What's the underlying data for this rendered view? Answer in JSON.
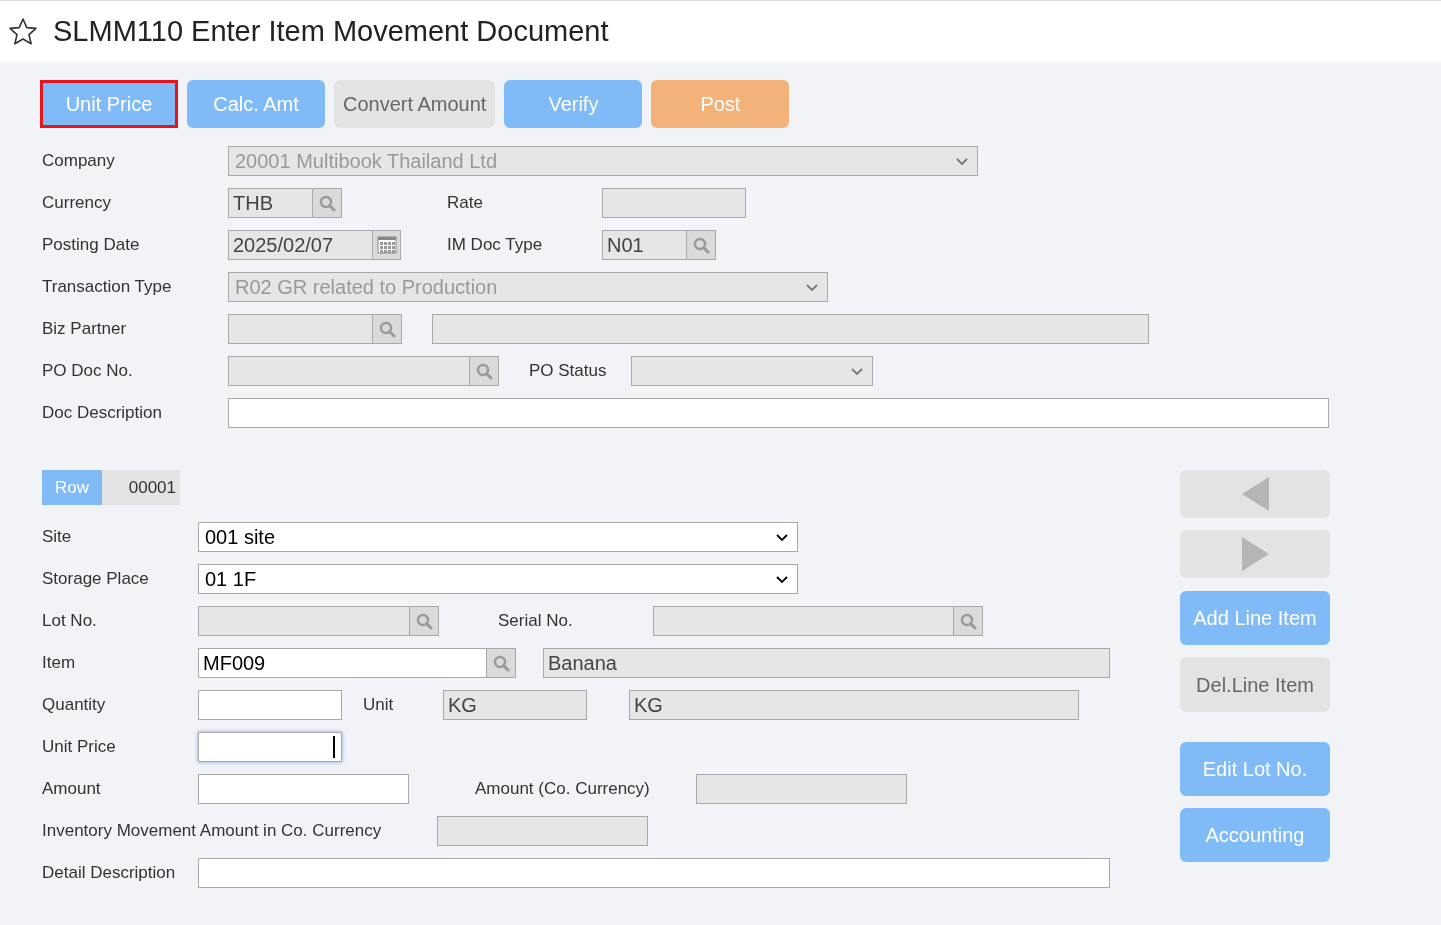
{
  "title": "SLMM110 Enter Item Movement Document",
  "starred": false,
  "toolbar": [
    {
      "label": "Unit Price",
      "kind": "primary",
      "focused": true
    },
    {
      "label": "Calc. Amt",
      "kind": "primary",
      "focused": false
    },
    {
      "label": "Convert Amount",
      "kind": "disabled",
      "focused": false
    },
    {
      "label": "Verify",
      "kind": "primary",
      "focused": false
    },
    {
      "label": "Post",
      "kind": "warning",
      "focused": false
    }
  ],
  "header": {
    "company": {
      "label": "Company",
      "value": "20001 Multibook Thailand Ltd",
      "disabled": true
    },
    "currency": {
      "label": "Currency",
      "value": "THB",
      "editable": false
    },
    "rate": {
      "label": "Rate",
      "editable": false
    },
    "posting_date": {
      "label": "Posting Date",
      "value": "2025/02/07",
      "editable": false
    },
    "im_doc_type": {
      "label": "IM Doc Type",
      "value": "N01",
      "editable": false
    },
    "transaction_type": {
      "label": "Transaction Type",
      "value": "R02 GR related to Production",
      "disabled": true
    },
    "biz_partner": {
      "label": "Biz Partner",
      "editable": false
    },
    "po_doc_no": {
      "label": "PO Doc No.",
      "editable": false
    },
    "po_status": {
      "label": "PO Status",
      "disabled": true
    },
    "doc_description": {
      "label": "Doc Description",
      "editable": true
    }
  },
  "line": {
    "row": {
      "label": "Row",
      "value": "00001"
    },
    "site": {
      "label": "Site",
      "value": "001 site",
      "disabled": false
    },
    "storage_place": {
      "label": "Storage Place",
      "value": "01 1F",
      "disabled": false
    },
    "lot_no": {
      "label": "Lot No.",
      "editable": false
    },
    "serial_no": {
      "label": "Serial No.",
      "editable": false
    },
    "item": {
      "label": "Item",
      "value": "MF009",
      "editable": true,
      "name": "Banana"
    },
    "quantity": {
      "label": "Quantity",
      "editable": true
    },
    "unit": {
      "label": "Unit",
      "value": "KG",
      "value_2": "KG"
    },
    "unit_price": {
      "label": "Unit Price",
      "editable": true,
      "focused": true
    },
    "amount": {
      "label": "Amount",
      "editable": true
    },
    "amount_co": {
      "label": "Amount (Co. Currency)",
      "editable": false
    },
    "inventory_amount": {
      "label": "Inventory Movement Amount in Co. Currency",
      "editable": false
    },
    "detail_description": {
      "label": "Detail Description",
      "editable": true
    }
  },
  "side_buttons": [
    {
      "kind": "previous",
      "disabled": true
    },
    {
      "kind": "next",
      "disabled": true
    },
    {
      "kind": "text",
      "label": "Add Line Item",
      "disabled": false
    },
    {
      "kind": "text",
      "label": "Del.Line Item",
      "disabled": true
    },
    {
      "kind": "text",
      "label": "Edit Lot No.",
      "disabled": false
    },
    {
      "kind": "text",
      "label": "Accounting",
      "disabled": false
    }
  ]
}
